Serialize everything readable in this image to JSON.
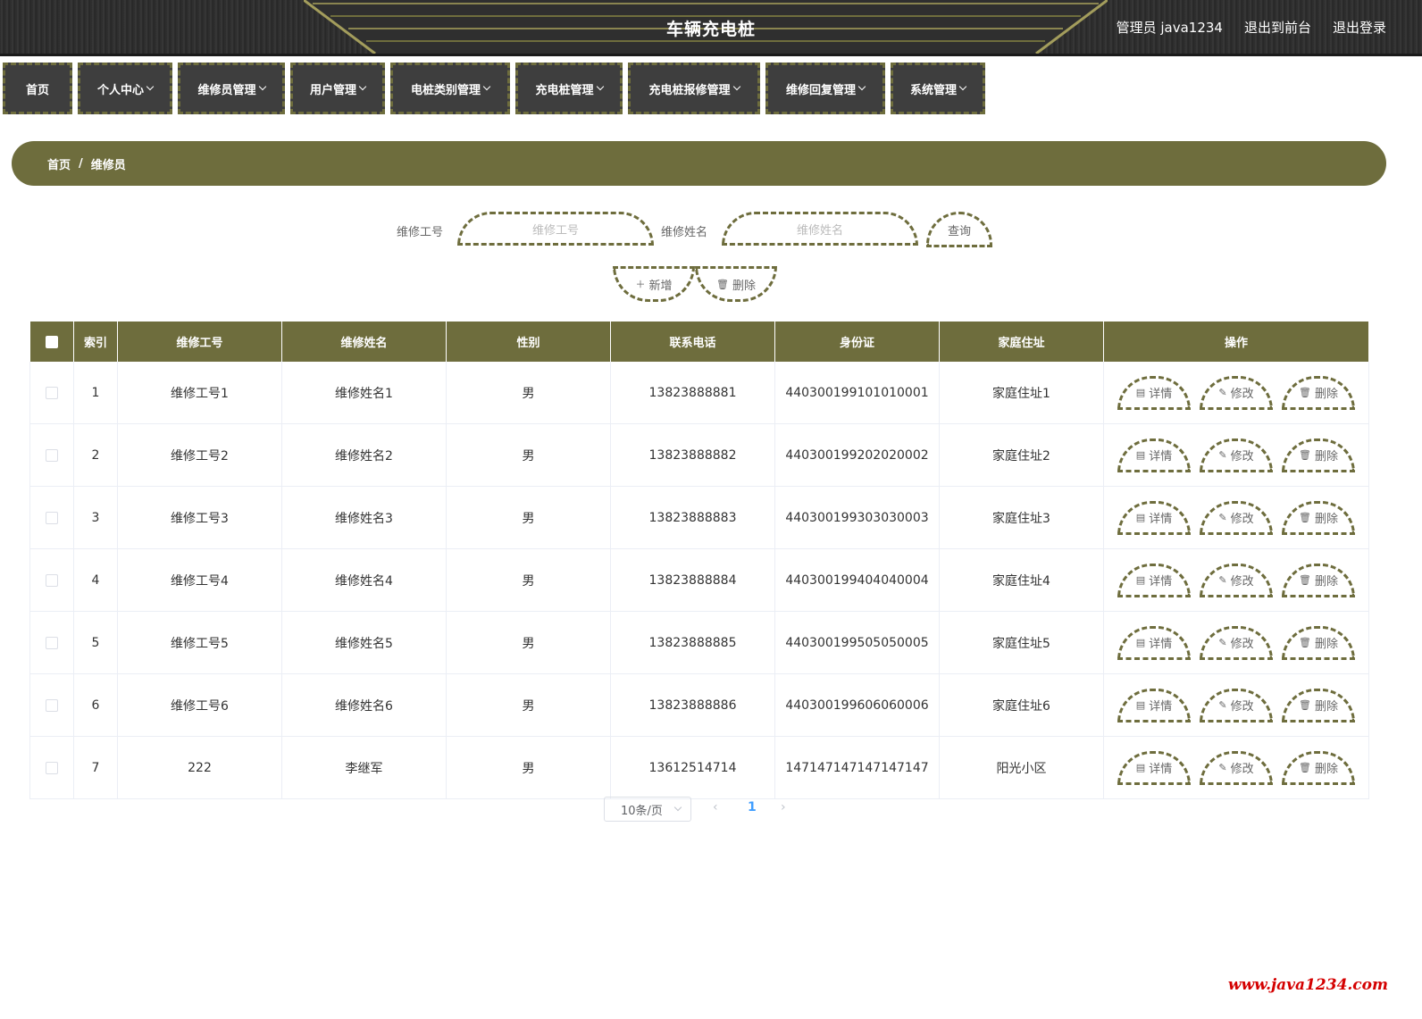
{
  "header": {
    "title": "车辆充电桩",
    "user_label": "管理员 java1234",
    "to_front": "退出到前台",
    "logout": "退出登录"
  },
  "nav": [
    {
      "label": "首页",
      "dropdown": false
    },
    {
      "label": "个人中心",
      "dropdown": true
    },
    {
      "label": "维修员管理",
      "dropdown": true
    },
    {
      "label": "用户管理",
      "dropdown": true
    },
    {
      "label": "电桩类别管理",
      "dropdown": true
    },
    {
      "label": "充电桩管理",
      "dropdown": true
    },
    {
      "label": "充电桩报修管理",
      "dropdown": true
    },
    {
      "label": "维修回复管理",
      "dropdown": true
    },
    {
      "label": "系统管理",
      "dropdown": true
    }
  ],
  "breadcrumb": {
    "home": "首页",
    "separator": "/",
    "current": "维修员"
  },
  "search": {
    "field1_label": "维修工号",
    "field1_placeholder": "维修工号",
    "field2_label": "维修姓名",
    "field2_placeholder": "维修姓名",
    "query_button": "查询",
    "add_button": "新增",
    "delete_button": "删除"
  },
  "table": {
    "columns": [
      "索引",
      "维修工号",
      "维修姓名",
      "性别",
      "联系电话",
      "身份证",
      "家庭住址",
      "操作"
    ],
    "rows": [
      {
        "index": "1",
        "job_no": "维修工号1",
        "name": "维修姓名1",
        "gender": "男",
        "phone": "13823888881",
        "id_card": "440300199101010001",
        "address": "家庭住址1"
      },
      {
        "index": "2",
        "job_no": "维修工号2",
        "name": "维修姓名2",
        "gender": "男",
        "phone": "13823888882",
        "id_card": "440300199202020002",
        "address": "家庭住址2"
      },
      {
        "index": "3",
        "job_no": "维修工号3",
        "name": "维修姓名3",
        "gender": "男",
        "phone": "13823888883",
        "id_card": "440300199303030003",
        "address": "家庭住址3"
      },
      {
        "index": "4",
        "job_no": "维修工号4",
        "name": "维修姓名4",
        "gender": "男",
        "phone": "13823888884",
        "id_card": "440300199404040004",
        "address": "家庭住址4"
      },
      {
        "index": "5",
        "job_no": "维修工号5",
        "name": "维修姓名5",
        "gender": "男",
        "phone": "13823888885",
        "id_card": "440300199505050005",
        "address": "家庭住址5"
      },
      {
        "index": "6",
        "job_no": "维修工号6",
        "name": "维修姓名6",
        "gender": "男",
        "phone": "13823888886",
        "id_card": "440300199606060006",
        "address": "家庭住址6"
      },
      {
        "index": "7",
        "job_no": "222",
        "name": "李继军",
        "gender": "男",
        "phone": "13612514714",
        "id_card": "147147147147147147",
        "address": "阳光小区"
      }
    ],
    "actions": {
      "detail": "详情",
      "edit": "修改",
      "delete": "删除"
    }
  },
  "pagination": {
    "page_size": "10条/页",
    "current_page": "1"
  },
  "watermark": "www.java1234.com",
  "colors": {
    "accent": "#6e6d3d",
    "header_bg": "#2b2b2b",
    "nav_bg": "#3e3e3e",
    "watermark": "#d40000"
  }
}
